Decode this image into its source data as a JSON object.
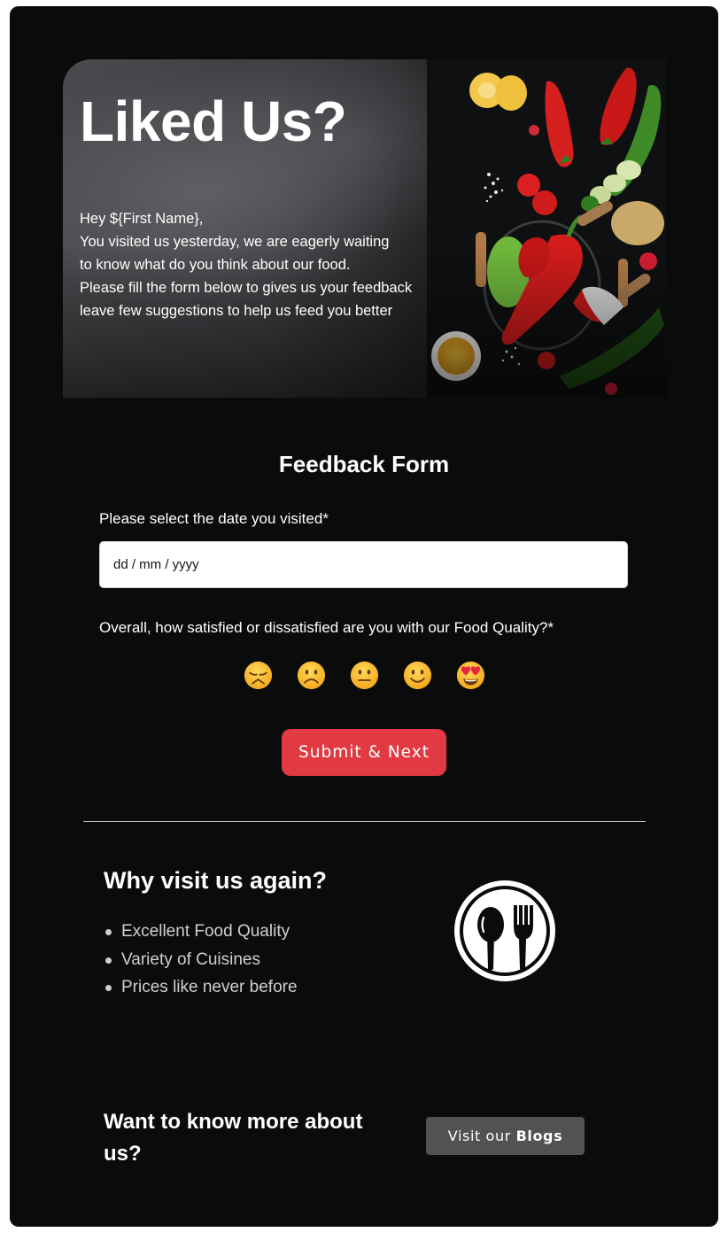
{
  "hero": {
    "title": "Liked Us?",
    "lines": [
      "Hey ${First Name},",
      "You visited us yesterday, we are eagerly waiting",
      "to know what do you think about our food.",
      "Please fill the form below to gives us your feedback",
      "leave few suggestions to help us feed you better"
    ],
    "image_alt": "vegetables-on-dark-table"
  },
  "form": {
    "title": "Feedback Form",
    "date_label": "Please select the date you visited*",
    "date_placeholder": "dd / mm / yyyy",
    "date_value": "",
    "rating_label": "Overall, how satisfied or dissatisfied are you with our Food Quality?*",
    "rating_options": [
      {
        "name": "disappointed",
        "label": "Very dissatisfied"
      },
      {
        "name": "slightly-frowning",
        "label": "Dissatisfied"
      },
      {
        "name": "neutral",
        "label": "Neutral"
      },
      {
        "name": "slightly-smiling",
        "label": "Satisfied"
      },
      {
        "name": "heart-eyes",
        "label": "Very satisfied"
      }
    ],
    "submit_label": "Submit & Next"
  },
  "why": {
    "title": "Why visit us again?",
    "items": [
      "Excellent Food Quality",
      "Variety of Cuisines",
      "Prices like never before"
    ],
    "icon": "cutlery-icon"
  },
  "more": {
    "title": "Want to know more about us?",
    "button_prefix": "Visit our",
    "button_bold": "Blogs"
  },
  "colors": {
    "background": "#0a0c0c",
    "accent": "#e23a43",
    "secondary_button": "#525252",
    "text": "#ffffff",
    "muted_text": "#cfcfcf"
  }
}
